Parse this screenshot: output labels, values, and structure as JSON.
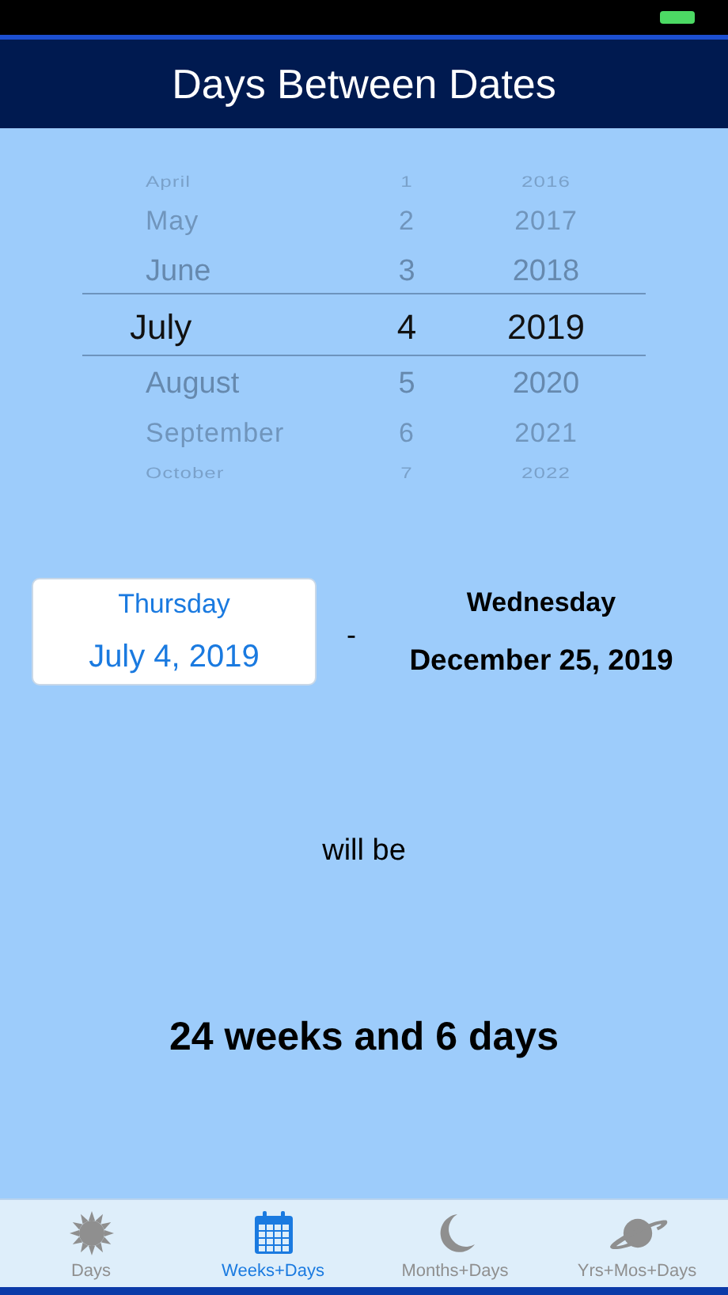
{
  "header": {
    "title": "Days Between Dates"
  },
  "picker": {
    "columns": [
      {
        "kind": "month",
        "items": [
          {
            "label": "April",
            "selected": false
          },
          {
            "label": "May",
            "selected": false
          },
          {
            "label": "June",
            "selected": false
          },
          {
            "label": "July",
            "selected": true
          },
          {
            "label": "August",
            "selected": false
          },
          {
            "label": "September",
            "selected": false
          },
          {
            "label": "October",
            "selected": false
          }
        ]
      },
      {
        "kind": "day",
        "items": [
          {
            "label": "1",
            "selected": false
          },
          {
            "label": "2",
            "selected": false
          },
          {
            "label": "3",
            "selected": false
          },
          {
            "label": "4",
            "selected": true
          },
          {
            "label": "5",
            "selected": false
          },
          {
            "label": "6",
            "selected": false
          },
          {
            "label": "7",
            "selected": false
          }
        ]
      },
      {
        "kind": "year",
        "items": [
          {
            "label": "2016",
            "selected": false
          },
          {
            "label": "2017",
            "selected": false
          },
          {
            "label": "2018",
            "selected": false
          },
          {
            "label": "2019",
            "selected": true
          },
          {
            "label": "2020",
            "selected": false
          },
          {
            "label": "2021",
            "selected": false
          },
          {
            "label": "2022",
            "selected": false
          }
        ]
      }
    ]
  },
  "dates": [
    {
      "weekday": "Thursday",
      "date": "July 4, 2019",
      "selected": true
    },
    {
      "weekday": "Wednesday",
      "date": "December 25, 2019",
      "selected": false
    }
  ],
  "separator": "-",
  "connector": "will be",
  "result": "24 weeks and 6 days",
  "tabs": [
    {
      "kind": "sun",
      "label": "Days",
      "selected": false
    },
    {
      "kind": "calendar",
      "label": "Weeks+Days",
      "selected": true
    },
    {
      "kind": "moon",
      "label": "Months+Days",
      "selected": false
    },
    {
      "kind": "planet",
      "label": "Yrs+Mos+Days",
      "selected": false
    }
  ]
}
